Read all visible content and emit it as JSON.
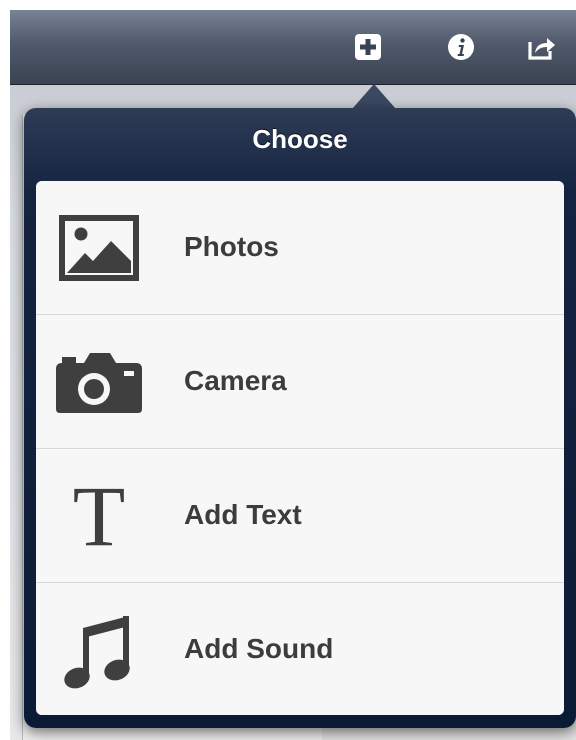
{
  "toolbar": {
    "buttons": [
      {
        "name": "add",
        "icon": "plus-square-icon"
      },
      {
        "name": "info",
        "icon": "info-icon"
      },
      {
        "name": "share",
        "icon": "share-icon"
      }
    ]
  },
  "popover": {
    "title": "Choose",
    "items": [
      {
        "label": "Photos",
        "icon": "photo-icon"
      },
      {
        "label": "Camera",
        "icon": "camera-icon"
      },
      {
        "label": "Add Text",
        "icon": "text-t-icon",
        "glyph": "T"
      },
      {
        "label": "Add Sound",
        "icon": "music-note-icon"
      }
    ]
  },
  "colors": {
    "toolbar": "#505a6b",
    "popover_frame": "#0c1b35",
    "list_background": "#f7f7f7",
    "label_text": "#3c3c3c",
    "icon_gray": "#3f3f3f"
  }
}
